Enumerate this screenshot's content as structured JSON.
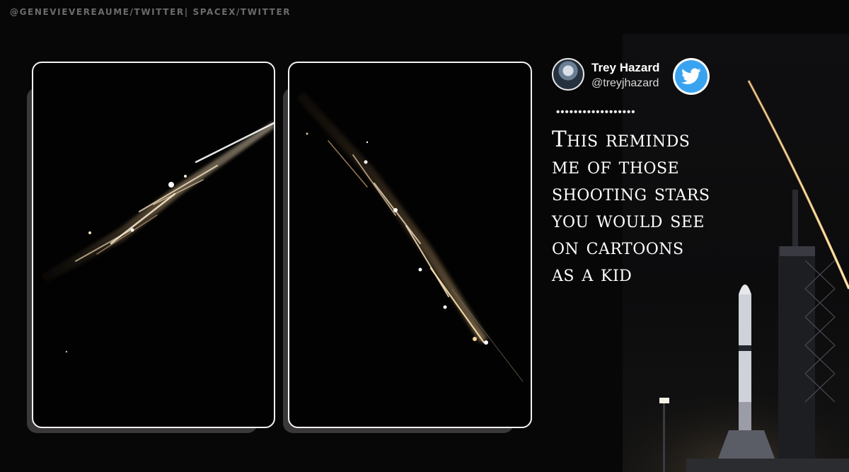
{
  "photo_credit": "@GENEVIEVEREAUME/TWITTER| SPACEX/TWITTER",
  "panels": [
    {
      "description_icon": "meteor-streak-photo"
    },
    {
      "description_icon": "meteor-streak-photo"
    }
  ],
  "tweet": {
    "author_name": "Trey Hazard",
    "author_handle": "@treyjhazard",
    "separator": "••••••••••••••••••",
    "quote_lines": [
      "This reminds",
      "me of those",
      "shooting stars",
      "you would see",
      "on cartoons",
      "as a kid"
    ]
  },
  "colors": {
    "background": "#080707",
    "twitter_blue": "#3aa3f0",
    "panel_border": "#f2f2f2"
  },
  "icons": {
    "twitter": "twitter-bird-icon",
    "avatar": "avatar"
  }
}
